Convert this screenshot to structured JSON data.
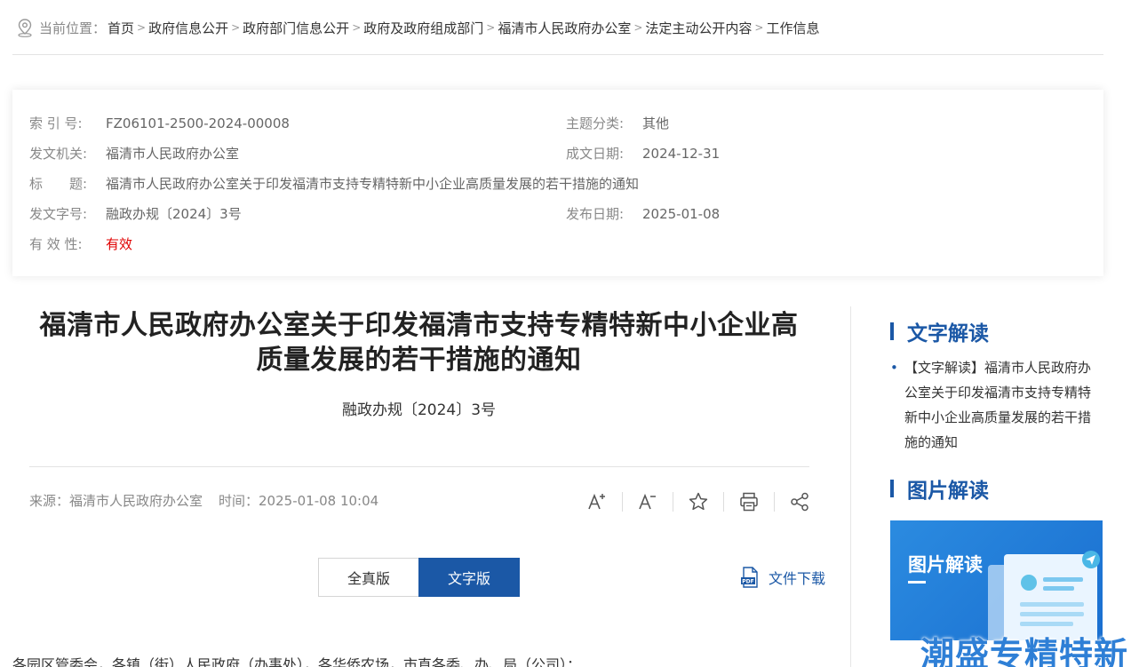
{
  "breadcrumb": {
    "prefix": "当前位置：",
    "items": [
      "首页",
      "政府信息公开",
      "政府部门信息公开",
      "政府及政府组成部门",
      "福清市人民政府办公室",
      "法定主动公开内容",
      "工作信息"
    ]
  },
  "meta": {
    "index_label": "索 引 号:",
    "index_value": "FZ06101-2500-2024-00008",
    "topic_label": "主题分类:",
    "topic_value": "其他",
    "issuer_label": "发文机关:",
    "issuer_value": "福清市人民政府办公室",
    "created_label": "成文日期:",
    "created_value": "2024-12-31",
    "title_label": "标　　题:",
    "title_value": "福清市人民政府办公室关于印发福清市支持专精特新中小企业高质量发展的若干措施的通知",
    "docno_label": "发文字号:",
    "docno_value": "融政办规〔2024〕3号",
    "published_label": "发布日期:",
    "published_value": "2025-01-08",
    "validity_label": "有 效 性:",
    "validity_value": "有效",
    "validity_color": "#e00000"
  },
  "article": {
    "title_line1": "福清市人民政府办公室关于印发福清市支持专精特新中小企业高",
    "title_line2": "质量发展的若干措施的通知",
    "docno": "融政办规〔2024〕3号",
    "source": "来源：福清市人民政府办公室",
    "time": "时间：2025-01-08 10:04",
    "tools": [
      "font-increase-icon",
      "font-decrease-icon",
      "star-icon",
      "print-icon",
      "share-icon"
    ],
    "version_full": "全真版",
    "version_text": "文字版",
    "download": "文件下载",
    "body_first_line": "各园区管委会，各镇（街）人民政府（办事处），各华侨农场，市直各委、办、局（公司）："
  },
  "sidebar": {
    "text_heading": "文字解读",
    "text_items": [
      "【文字解读】福清市人民政府办公室关于印发福清市支持专精特新中小企业高质量发展的若干措施的通知"
    ],
    "pic_heading": "图片解读",
    "pic_banner_title": "图片解读"
  },
  "watermark": "潮盛专精特新",
  "colors": {
    "accent": "#1b58a6",
    "validity": "#e00000",
    "watermark": "#2e7fd6"
  }
}
